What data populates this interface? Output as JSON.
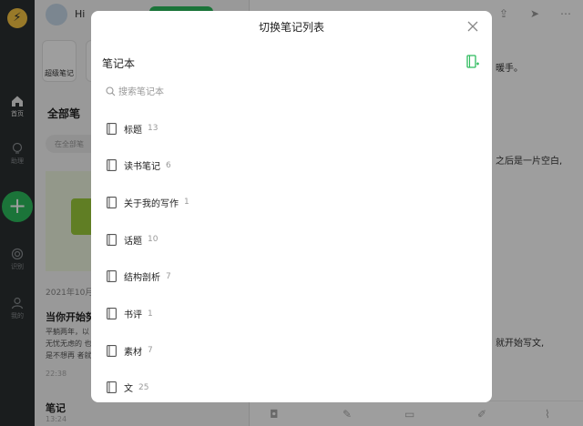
{
  "background": {
    "rail": {
      "nav": [
        {
          "icon": "home-icon",
          "label": "首页"
        },
        {
          "icon": "bulb-icon",
          "label": "助理"
        },
        {
          "icon": "target-icon",
          "label": "识别"
        },
        {
          "icon": "person-icon",
          "label": "我的"
        }
      ]
    },
    "list": {
      "greeting": "Hi",
      "super_note": "超级笔记",
      "all_notes": "全部笔",
      "search": "在全部笔",
      "date": "2021年10月",
      "note_title": "当你开始努",
      "note_body": "平躺两年，以 个无忧无虑的 也许是不想再 者就是想赚钱",
      "note_time": "22:38",
      "note2_title": "笔记",
      "note2_time": "13:24"
    },
    "editor": {
      "line1": "暖手。",
      "line2": "之后是一片空白,",
      "line3": "就开始写文,"
    }
  },
  "modal": {
    "title": "切换笔记列表",
    "section": "笔记本",
    "search_placeholder": "搜索笔记本",
    "notebooks": [
      {
        "name": "标题",
        "count": "13"
      },
      {
        "name": "读书笔记",
        "count": "6"
      },
      {
        "name": "关于我的写作",
        "count": "1"
      },
      {
        "name": "话题",
        "count": "10"
      },
      {
        "name": "结构剖析",
        "count": "7"
      },
      {
        "name": "书评",
        "count": "1"
      },
      {
        "name": "素材",
        "count": "7"
      },
      {
        "name": "文",
        "count": "25"
      }
    ]
  },
  "colors": {
    "accent": "#2dbb5d",
    "overlay": "rgba(0,0,0,0.38)"
  }
}
